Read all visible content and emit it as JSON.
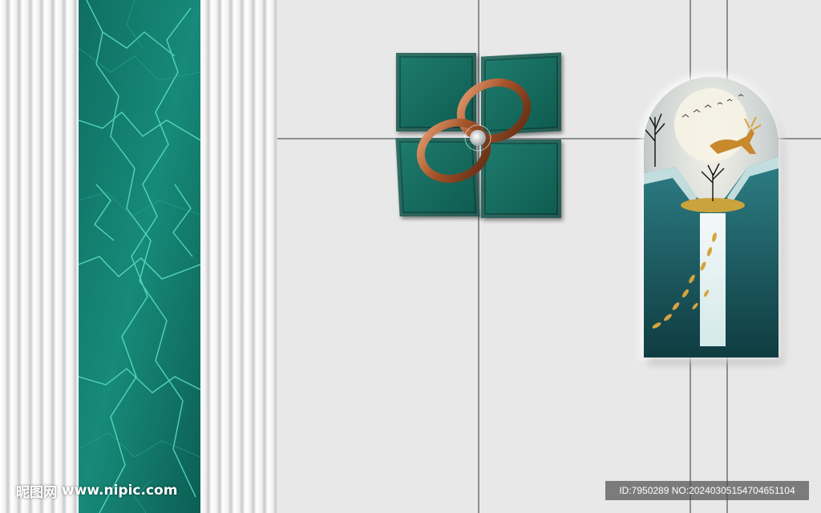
{
  "watermark": {
    "site_cn": "昵图网",
    "site_url": "www.nipic.com",
    "id_label": "ID:7950289 NO:20240305154704651104"
  },
  "colors": {
    "marble": "#127a6c",
    "wall": "#e8e8e9",
    "tile": "#1b7466",
    "copper": "#b8683a"
  }
}
